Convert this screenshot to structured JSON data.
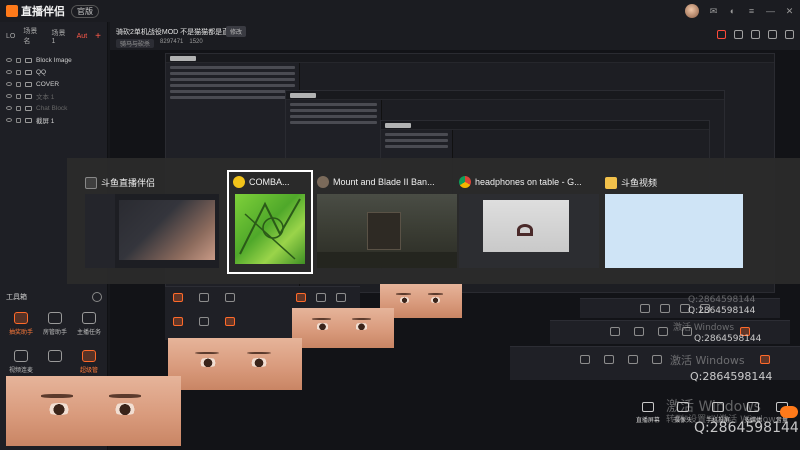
{
  "app": {
    "logo_text": "直播伴侣",
    "version_label": "官版"
  },
  "window_controls": [
    "avatar",
    "message-icon",
    "skin-icon",
    "menu-icon",
    "minimize-icon",
    "close-icon"
  ],
  "sidebar": {
    "tabs": [
      {
        "label": "LO",
        "active": false
      },
      {
        "label": "场景名",
        "active": false
      },
      {
        "label": "场景1",
        "active": false
      },
      {
        "label": "Aut",
        "active": true
      }
    ],
    "sources": [
      {
        "label": "Block Image",
        "dim": false
      },
      {
        "label": "QQ",
        "dim": false
      },
      {
        "label": "COVER",
        "dim": false
      },
      {
        "label": "文本 1",
        "dim": true
      },
      {
        "label": "Chat Block",
        "dim": true
      },
      {
        "label": "截屏 1",
        "dim": false
      }
    ],
    "toolbox": {
      "title": "工具箱",
      "tools": [
        {
          "label": "抽奖助手",
          "highlight": true
        },
        {
          "label": "房管助手",
          "highlight": false
        },
        {
          "label": "主播任务",
          "highlight": false
        },
        {
          "label": "视频连麦",
          "highlight": false
        },
        {
          "label": "",
          "highlight": false
        },
        {
          "label": "超级管",
          "highlight": true
        }
      ]
    }
  },
  "room": {
    "title": "骑砍2单机战役MOD 不是猫猫都是直播",
    "edit_label": "修改",
    "category": "骑马与砍杀",
    "room_id": "8297471",
    "viewers": "1520"
  },
  "live_controls": [
    {
      "label": "直播屏幕",
      "icon": "screen-icon"
    },
    {
      "label": "摄像头",
      "icon": "camera-icon"
    },
    {
      "label": "手机投屏",
      "icon": "phone-icon"
    },
    {
      "label": "多媒体",
      "icon": "media-icon"
    },
    {
      "label": "音量",
      "icon": "volume-icon"
    }
  ],
  "watermark": {
    "activate": "激活 Windows",
    "activate_sub": "转到\"设置\"以激活 Windows",
    "qq": "Q:2864598144"
  },
  "switcher": {
    "items": [
      {
        "label": "斗鱼直播伴侣",
        "icon": "douyu-companion-icon",
        "selected": false
      },
      {
        "label": "COMBA...",
        "icon": "game-icon",
        "selected": true
      },
      {
        "label": "Mount and Blade II Ban...",
        "icon": "bannerlord-icon",
        "selected": false
      },
      {
        "label": "headphones on table - G...",
        "icon": "chrome-icon",
        "selected": false
      },
      {
        "label": "斗鱼视频",
        "icon": "folder-icon",
        "selected": false
      }
    ]
  },
  "colors": {
    "accent": "#ff6a2a",
    "active_tab": "#ff5a4a",
    "background": "#16171b",
    "switcher_bg": "#2b2b2b"
  }
}
